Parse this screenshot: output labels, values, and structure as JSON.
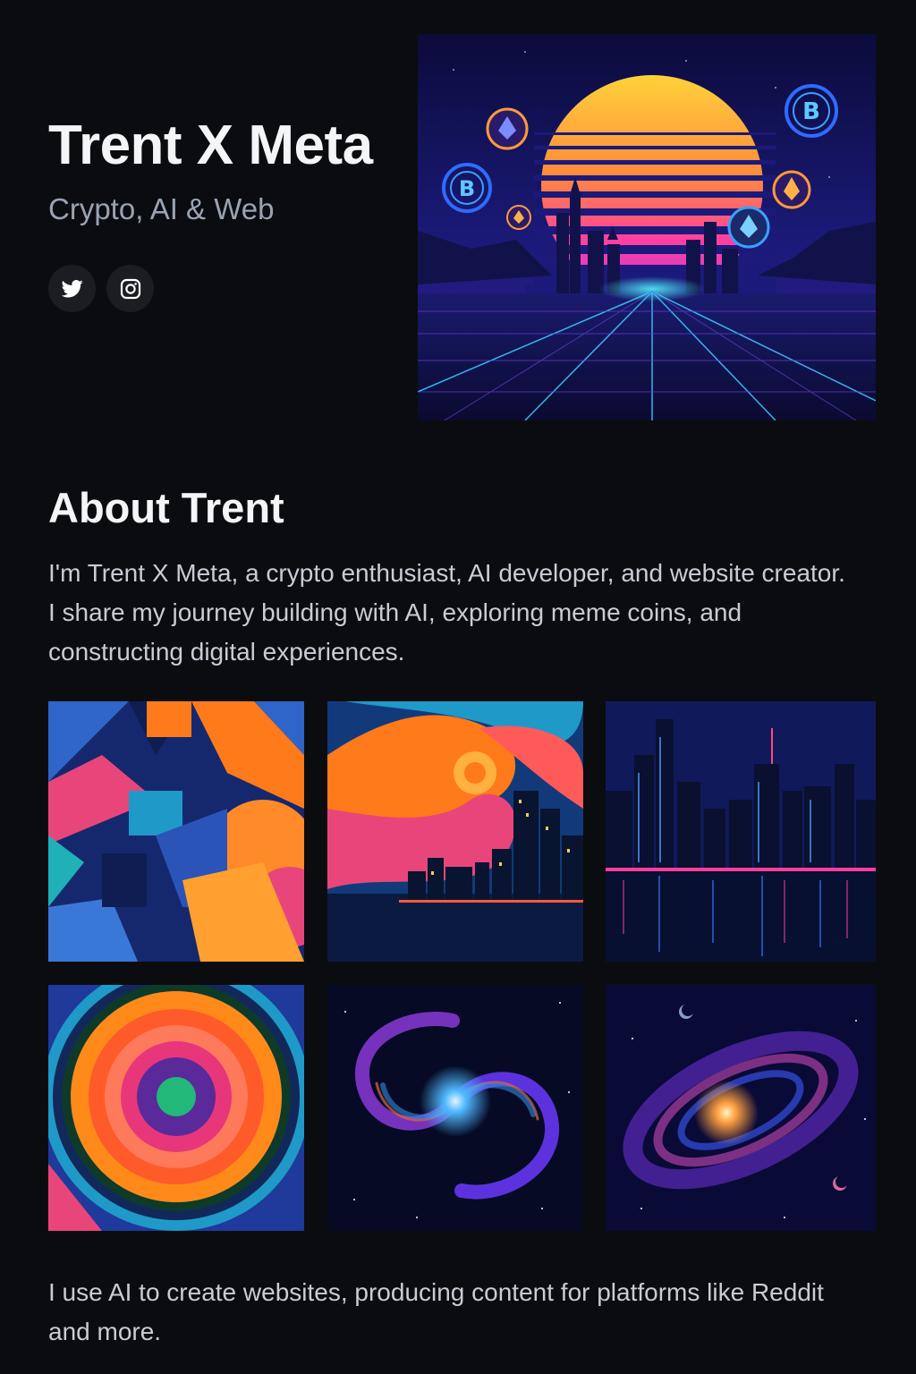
{
  "header": {
    "title": "Trent X Meta",
    "subtitle": "Crypto, AI & Web"
  },
  "socials": [
    {
      "icon": "twitter-icon"
    },
    {
      "icon": "instagram-icon"
    }
  ],
  "hero": {
    "image": "synthwave-city-sunset-with-crypto-coins",
    "coin_symbols": [
      "B",
      "B"
    ]
  },
  "about": {
    "heading": "About Trent",
    "paragraph": "I'm Trent X Meta, a crypto enthusiast, AI developer, and website creator. I share my journey building with AI, exploring meme coins, and constructing digital experiences."
  },
  "gallery": [
    {
      "image": "geometric-abstract-art"
    },
    {
      "image": "swirl-over-city-skyline"
    },
    {
      "image": "neon-city-night-reflection"
    },
    {
      "image": "concentric-circles-art"
    },
    {
      "image": "spiral-galaxy-blue"
    },
    {
      "image": "spiral-galaxy-purple"
    }
  ],
  "footer": {
    "paragraph": "I use AI to create websites, producing content for platforms like Reddit and more."
  },
  "colors": {
    "background": "#0b0c10",
    "heading": "#f4f5f7",
    "subtitle": "#9aa3b2",
    "body_text": "#c8ccd4",
    "social_button": "#1b1d22"
  }
}
